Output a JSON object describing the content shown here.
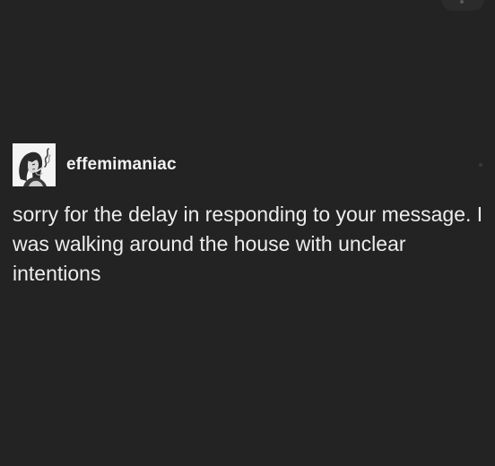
{
  "post": {
    "author": {
      "username": "effemimaniac",
      "avatar_icon": "avatar-illustration-icon"
    },
    "text": "sorry for the delay in responding to your message. I was walking around the house with unclear intentions"
  },
  "colors": {
    "background": "#232323",
    "text": "#ececec"
  }
}
